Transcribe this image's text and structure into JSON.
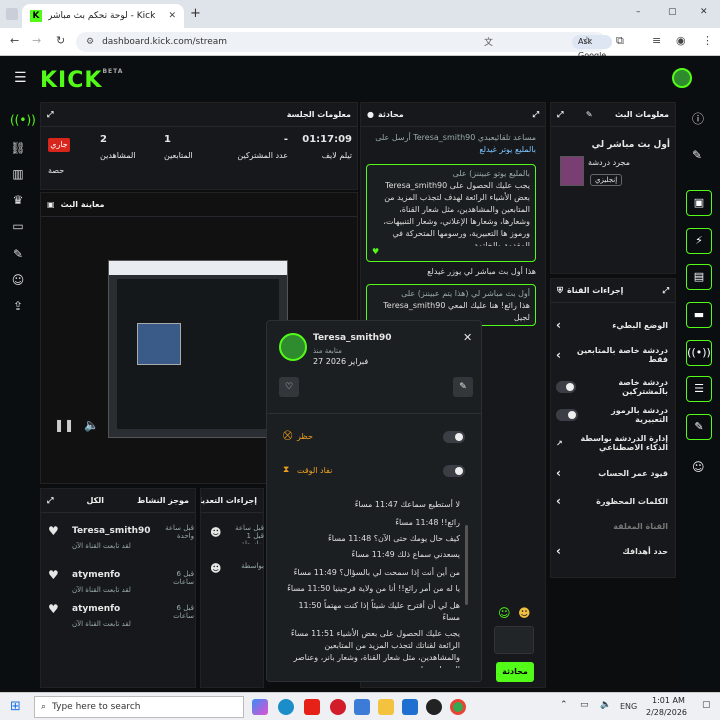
{
  "browser": {
    "tab_title": "Kick - لوحة تحكم بث مباشر",
    "url": "dashboard.kick.com/stream",
    "ask_google": "Ask Google",
    "new_tab": "+",
    "window_controls": [
      "–",
      "▢",
      "✕"
    ]
  },
  "kick": {
    "logo": "KICK",
    "logo_beta": "BETA"
  },
  "session": {
    "title": "معلومات الجلسة",
    "live_badge": "جاري",
    "stats": [
      {
        "value": "01:17:09",
        "label": "تيلم لايف"
      },
      {
        "value": "-",
        "label": "عدد المشتركين"
      },
      {
        "value": "1",
        "label": "المتابعين"
      },
      {
        "value": "2",
        "label": "المشاهدين"
      },
      {
        "value": "",
        "label": "حصة"
      }
    ]
  },
  "preview": {
    "title": "معاينة البث"
  },
  "chat": {
    "title": "محادثة",
    "messages": [
      {
        "header": "مساعد تلقائيعبدي Teresa_smith90 أرسل على",
        "sub": "بالمليع يوتر غيدلع"
      },
      {
        "header": "بالمليع يوتو عبيننز) على",
        "body": "يجب عليك الحصول على Teresa_smith90 بعض الأشياء الرائعة لهدف لتجذب المزيد من المتابعين والمشاهدين، مثل شعار القناة، وشعارها، وشعارها الإعلاني، وشعار التنبيهات، ورموز ها التعبيرية، ورسومها المتحركة في المقدمة والخاتمة"
      },
      {
        "header": "هذا أول بث مباشر لي يوزر غيدلع"
      },
      {
        "header": "أول بث مباشر لي (هذا يتم عبيننز) على",
        "body": "هذا رائع! هنا عليك المعي Teresa_smith90 لجيل"
      }
    ],
    "send_label": "محادثة"
  },
  "stream_info": {
    "title": "معلومات البث",
    "stream_title": "أول بث مباشر لي",
    "category": "مجرد دردشة",
    "language": "إنجليزي"
  },
  "channel_actions": {
    "title": "إجراءات القناة",
    "rows": [
      {
        "label": "الوضع البطيء",
        "control": "chevron"
      },
      {
        "label": "دردشة خاصة بالمتابعين فقط",
        "control": "chevron"
      },
      {
        "label": "دردشة خاصة بالمشتركين",
        "control": "toggle"
      },
      {
        "label": "دردشة بالرموز التعبيرية",
        "control": "toggle"
      },
      {
        "label": "إدارة الدردشة بواسطة الذكاء الاصطناعي",
        "control": "link"
      },
      {
        "label": "قيود عمر الحساب",
        "control": "chevron"
      },
      {
        "label": "الكلمات المحظورة",
        "control": "chevron"
      },
      {
        "label": "القناة المغلقة",
        "control": "none"
      },
      {
        "label": "حدد أهدافك",
        "control": "chevron"
      }
    ]
  },
  "activity": {
    "title": "موجز النشاط",
    "tab_all": "الكل",
    "items": [
      {
        "user": "Teresa_smith90",
        "desc": "لقد تابعت القناة الآن",
        "time": "قبل ساعة واحدة"
      },
      {
        "user": "atymenfo",
        "desc": "لقد تابعت القناة الآن",
        "time": "قبل 6 ساعات"
      },
      {
        "user": "atymenfo",
        "desc": "لقد تابعت القناة الآن",
        "time": "قبل 6 ساعات"
      }
    ]
  },
  "mod_actions": {
    "title": "إجراءات التعديل",
    "rows": [
      "قبل ساعة قبل 1 بواسطة",
      "بواسطة"
    ]
  },
  "modal": {
    "username": "Teresa_smith90",
    "role": "متابعة منذ",
    "date": "27 فبراير 2026",
    "ban_label": "حظر",
    "timeout_label": "نفاد الوقت",
    "log": [
      "لا أستطيع سماعك 11:47 مساءً",
      "رائع!! 11:48 مساءً",
      "كيف حال يومك حتى الآن؟ 11:48 مساءً",
      "يسعدني سماع ذلك 11:49 مساءً",
      "من أين أنت إذا سمحت لي بالسؤال؟ 11:49 مساءً",
      "يا له من أمر رائع!! أنا من ولاية فرجينيا 11:50 مساءً",
      "هل لي أن أقترح عليك شيئاً إذا كنت مهتماً 11:50 مساءً",
      "يجب عليك الحصول على بعض الأشياء 11:51 مساءً الرائعة لقناتك لتجذب المزيد من المتابعين والمشاهدين، مثل شعار القناة، وشعار بانر، وعناصر التنبيهات، ولوحة"
    ]
  },
  "taskbar": {
    "search_placeholder": "Type here to search",
    "lang": "ENG",
    "time": "1:01 AM",
    "date": "2/28/2026"
  },
  "colors": {
    "accent": "#53fc18",
    "panel": "#16181b",
    "bg": "#0b0d0f",
    "live_red": "#d9261c"
  }
}
